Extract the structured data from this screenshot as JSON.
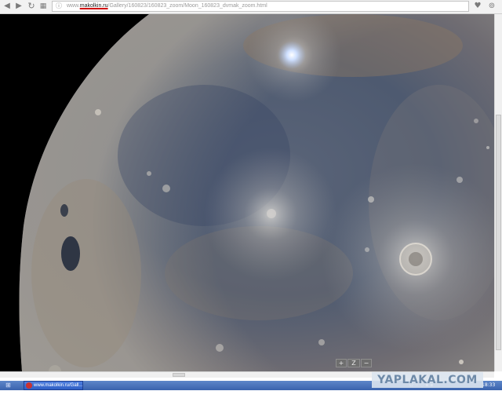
{
  "browser": {
    "url": {
      "prefix": "www.",
      "host": "makolkin.ru",
      "path": "/Gallery/160823/160823_zoom/Moon_160823_dvmak_zoom.html"
    },
    "icons": {
      "back": "back-arrow-icon",
      "forward": "forward-arrow-icon",
      "reload": "reload-icon",
      "apps": "apps-grid-icon",
      "site_info": "page-info-icon",
      "bookmark": "heart-icon",
      "menu": "extension-icon"
    }
  },
  "viewer": {
    "zoom_in_label": "+",
    "zoom_fit_label": "Z",
    "zoom_out_label": "−"
  },
  "taskbar": {
    "task_label": "www.makolkin.ru/Gall...",
    "tray_text": "Ω·☼·◇·▪ ▪",
    "clock": "18:33",
    "accent": "#3a63ad"
  },
  "watermark": {
    "text": "YAPLAKAL.COM"
  }
}
